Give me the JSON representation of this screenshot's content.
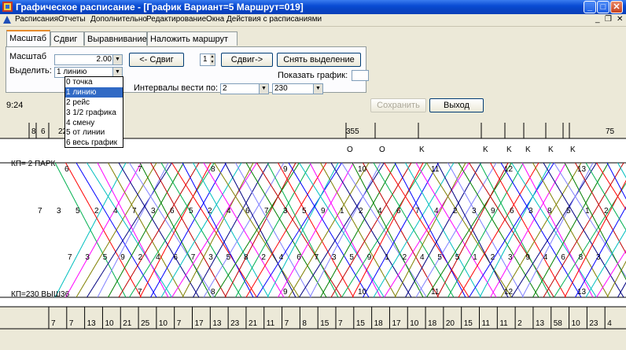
{
  "window": {
    "title": "Графическое расписание - [График Вариант=5 Маршрут=019]",
    "minimize": "_",
    "maximize": "□",
    "close": "✕"
  },
  "menu": {
    "items": [
      "Расписания",
      "Отчеты",
      "Дополнительно",
      "Редактирование",
      "Окна",
      "Действия с расписаниями"
    ],
    "mdi_minimize": "_",
    "mdi_restore": "❐",
    "mdi_close": "✕"
  },
  "tabs": [
    {
      "label": "Масштаб",
      "active": true
    },
    {
      "label": "Сдвиг",
      "active": false
    },
    {
      "label": "Выравнивание",
      "active": false
    },
    {
      "label": "Наложить маршрут",
      "active": false
    }
  ],
  "panel": {
    "scale_label": "Масштаб",
    "scale_value": "2.00",
    "select_label": "Выделить:",
    "select_value": "1 линию",
    "shift_left_button": "<- Сдвиг",
    "spin_value": "1",
    "shift_right_button": "Сдвиг->",
    "clear_selection_button": "Снять выделение",
    "show_chart_label": "Показать график:",
    "show_chart_value": "",
    "intervals_label": "Интервалы вести по:",
    "intervals_value": "2",
    "intervals_value2": "230"
  },
  "dropdown": {
    "options": [
      "0 точка",
      "1 линию",
      "2 рейс",
      "3 1/2 графика",
      "4 смену",
      "5 от линии",
      "6 весь график"
    ],
    "selected_index": 1
  },
  "time_label": "9:24",
  "save_button": "Сохранить",
  "exit_button": "Выход",
  "chart_data": {
    "type": "line",
    "top_station": "КП= 2 ПАРК",
    "bottom_station": "КП=230 ВЫШ36",
    "top_axis_labels": [
      "8",
      "6",
      "22",
      "355",
      "75"
    ],
    "markers": [
      "O",
      "O",
      "K",
      "K",
      "K",
      "K",
      "K",
      "K"
    ],
    "top_trip_numbers": [
      "6",
      "7",
      "8",
      "9",
      "10",
      "11",
      "12",
      "13"
    ],
    "bottom_trip_numbers": [
      "7",
      "8",
      "9",
      "10",
      "11",
      "12",
      "13"
    ],
    "upper_row_labels": [
      "7",
      "3",
      "5",
      "2",
      "4",
      "7",
      "3",
      "6",
      "5",
      "2",
      "4",
      "6",
      "7",
      "3",
      "5",
      "9",
      "1",
      "2",
      "4",
      "6",
      "7",
      "4",
      "2",
      "3",
      "9",
      "6",
      "3",
      "8",
      "5",
      "1",
      "2"
    ],
    "lower_row_labels": [
      "7",
      "3",
      "5",
      "9",
      "2",
      "4",
      "6",
      "7",
      "3",
      "5",
      "8",
      "2",
      "4",
      "6",
      "7",
      "3",
      "5",
      "9",
      "1",
      "2",
      "4",
      "5",
      "5",
      "1",
      "2",
      "3",
      "9",
      "4",
      "6",
      "8",
      "3"
    ],
    "bottom_axis_labels": [
      "7",
      "7",
      "13",
      "10",
      "21",
      "25",
      "10",
      "7",
      "17",
      "13",
      "23",
      "21",
      "11",
      "7",
      "8",
      "15",
      "7",
      "15",
      "18",
      "17",
      "10",
      "18",
      "20",
      "15",
      "11",
      "11",
      "2",
      "13",
      "58",
      "10",
      "23",
      "4"
    ],
    "colors": [
      "#00b050",
      "#ff0000",
      "#0000ff",
      "#00bfbf",
      "#ff00ff",
      "#808000",
      "#000080",
      "#8080ff",
      "#008000",
      "#c00000"
    ]
  }
}
